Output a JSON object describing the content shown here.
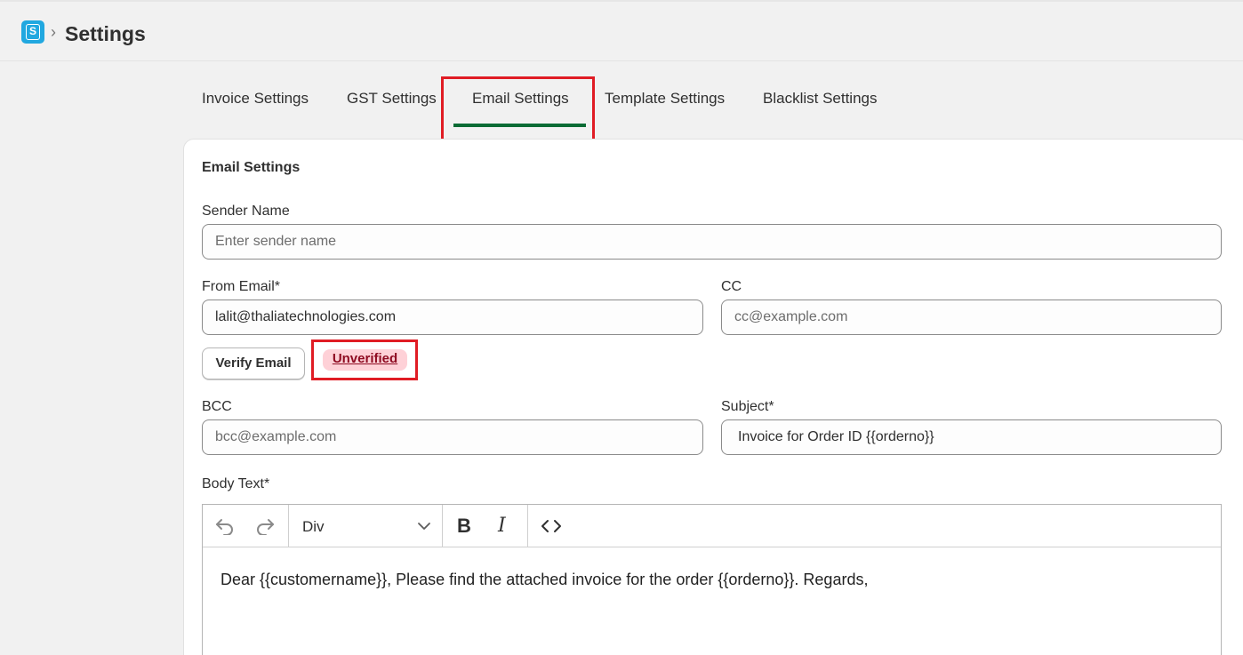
{
  "header": {
    "title": "Settings",
    "breadcrumb_sep": "›"
  },
  "tabs": [
    {
      "label": "Invoice Settings",
      "active": false
    },
    {
      "label": "GST Settings",
      "active": false
    },
    {
      "label": "Email Settings",
      "active": true
    },
    {
      "label": "Template Settings",
      "active": false
    },
    {
      "label": "Blacklist Settings",
      "active": false
    }
  ],
  "form": {
    "section_title": "Email Settings",
    "sender_name": {
      "label": "Sender Name",
      "value": "",
      "placeholder": "Enter sender name"
    },
    "from_email": {
      "label": "From Email*",
      "value": "lalit@thaliatechnologies.com",
      "placeholder": ""
    },
    "cc": {
      "label": "CC",
      "value": "",
      "placeholder": "cc@example.com"
    },
    "verify_label": "Verify Email",
    "status_badge": "Unverified",
    "bcc": {
      "label": "BCC",
      "value": "",
      "placeholder": "bcc@example.com"
    },
    "subject": {
      "label": "Subject*",
      "value": "Invoice for Order ID {{orderno}}",
      "placeholder": ""
    },
    "body": {
      "label": "Body Text*",
      "block_format": "Div",
      "bold_glyph": "B",
      "italic_glyph": "I",
      "content": "Dear {{customername}}, Please find the attached invoice for the order {{orderno}}. Regards,"
    }
  },
  "colors": {
    "accent": "#0a6b34",
    "highlight": "#e01c24",
    "badge_bg": "#fed1d7",
    "badge_text": "#8e0b21",
    "logo": "#21a8e0"
  }
}
